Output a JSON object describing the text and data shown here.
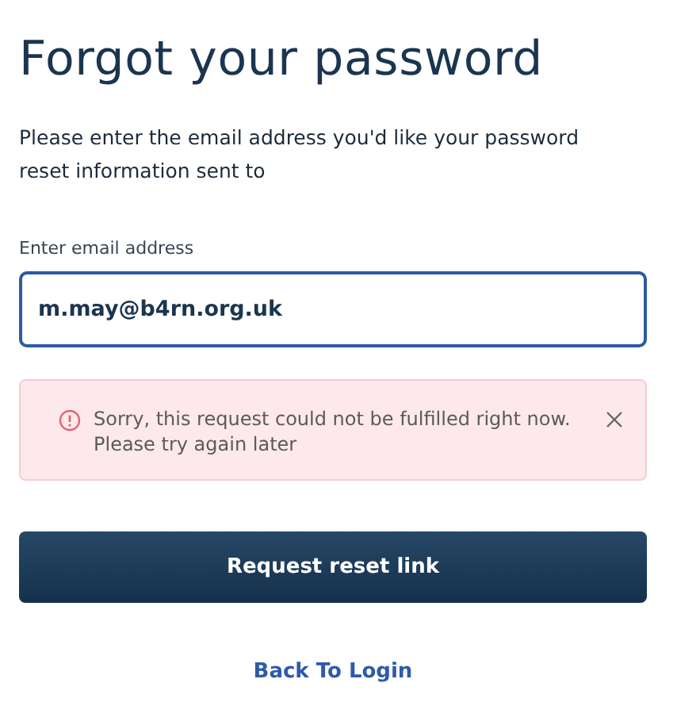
{
  "title": "Forgot your password",
  "instructions": "Please enter the email address you'd like your password reset information sent to",
  "email_field": {
    "label": "Enter email address",
    "value": "m.may@b4rn.org.uk"
  },
  "alert": {
    "kind": "error",
    "message": "Sorry, this request could not be fulfilled right now. Please try again later"
  },
  "submit_button": "Request reset link",
  "back_link": "Back To Login"
}
